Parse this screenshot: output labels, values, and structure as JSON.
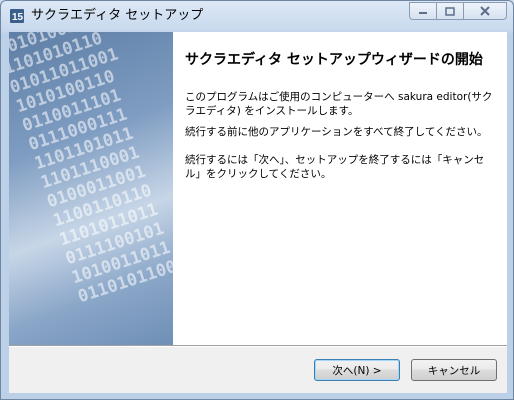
{
  "window": {
    "title": "サクラエディタ セットアップ",
    "controls": {
      "minimize": "minimize",
      "maximize": "maximize",
      "close": "close"
    }
  },
  "wizard": {
    "heading": "サクラエディタ セットアップウィザードの開始",
    "paragraph1": "このプログラムはご使用のコンピューターへ sakura editor(サクラエディタ) をインストールします。",
    "paragraph2": "続行する前に他のアプリケーションをすべて終了してください。",
    "paragraph3": "続行するには「次へ」、セットアップを終了するには「キャンセル」をクリックしてください。",
    "image_bits": [
      "0100001101",
      "1010100110",
      "1101010110",
      "01011011001",
      "1010100110",
      "0110011101",
      "0111000111",
      "1101101011",
      "1101110001",
      "0100011001",
      "1100110110",
      "1101011011",
      "0111100101",
      "1010011011",
      "0110101100"
    ]
  },
  "buttons": {
    "next": "次へ(N) >",
    "cancel": "キャンセル"
  }
}
